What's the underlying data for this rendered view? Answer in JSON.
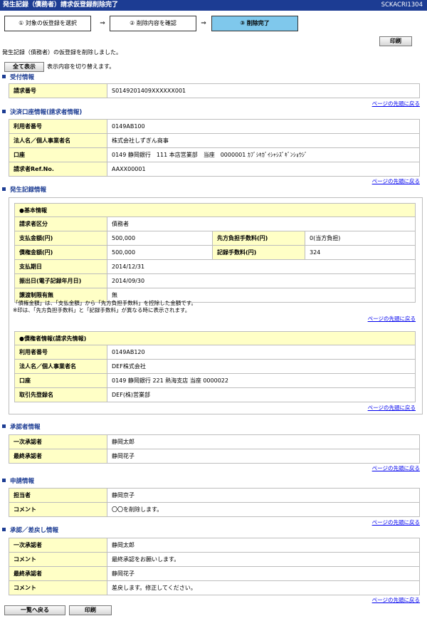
{
  "header": {
    "title": "発生記録（債務者）請求仮登録削除完了",
    "screen_code": "SCKACRI1304"
  },
  "steps": [
    {
      "label": "① 対象の仮登録を選択",
      "active": false
    },
    {
      "label": "② 削除内容を確認",
      "active": false
    },
    {
      "label": "③ 削除完了",
      "active": true
    }
  ],
  "step_arrow": "⇒",
  "buttons": {
    "print_top": "印刷",
    "show_all": "全て表示",
    "back_to_list": "一覧へ戻る",
    "print_bottom": "印刷"
  },
  "messages": {
    "completed": "発生記録（債務者）の仮登録を削除しました。",
    "toggle_hint": "表示内容を切り替えます。"
  },
  "page_top_link": "ページの先頭に戻る",
  "request_info": {
    "heading": "受付情報",
    "rows": [
      {
        "label": "請求番号",
        "value": "S0149201409XXXXXX001"
      }
    ]
  },
  "settlement_account": {
    "heading": "決済口座情報(請求者情報)",
    "rows": [
      {
        "label": "利用者番号",
        "value": "0149AB100"
      },
      {
        "label": "法人名／個人事業者名",
        "value": "株式会社しずぎん商事"
      },
      {
        "label": "口座",
        "value": "0149 静岡銀行　111 本店営業部　当座　0000001 ｶﾌﾞｼｷｶﾞｲｼｬｼｽﾞｷﾞﾝｼｮｳｼﾞ"
      },
      {
        "label": "請求者Ref.No.",
        "value": "AAXX00001"
      }
    ]
  },
  "record_info": {
    "heading": "発生記録情報",
    "basic": {
      "heading": "●基本情報",
      "requester_type_label": "請求者区分",
      "requester_type_value": "債務者",
      "payment_amount_label": "支払金額(円)",
      "payment_amount_value": "500,000",
      "fee_label": "先方負担手数料(円)",
      "fee_value": "0(当方負担)",
      "claim_amount_label": "債権金額(円)",
      "claim_amount_value": "500,000",
      "record_fee_label": "記録手数料(円)",
      "record_fee_value": "324",
      "due_date_label": "支払期日",
      "due_date_value": "2014/12/31",
      "issue_date_label": "振出日(電子記録年月日)",
      "issue_date_value": "2014/09/30",
      "transfer_limit_label": "譲渡制限有無",
      "transfer_limit_value": "無"
    },
    "notes": [
      "「債権金額」は、「支払金額」から「先方負担手数料」を控除した金額です。",
      "※印は、「先方負担手数料」と「記録手数料」が異なる時に表示されます。"
    ],
    "creditor": {
      "heading": "●債権者情報(請求先情報)",
      "rows": [
        {
          "label": "利用者番号",
          "value": "0149AB120"
        },
        {
          "label": "法人名／個人事業者名",
          "value": "DEF株式会社"
        },
        {
          "label": "口座",
          "value": "0149 静岡銀行 221 熱海支店 当座 0000022"
        },
        {
          "label": "取引先登録名",
          "value": "DEF(株)営業部"
        }
      ]
    }
  },
  "approver_info": {
    "heading": "承認者情報",
    "rows": [
      {
        "label": "一次承認者",
        "value": "静岡太郎"
      },
      {
        "label": "最終承認者",
        "value": "静岡花子"
      }
    ]
  },
  "application_info": {
    "heading": "申請情報",
    "rows": [
      {
        "label": "担当者",
        "value": "静岡京子"
      },
      {
        "label": "コメント",
        "value": "〇〇を削除します。"
      }
    ]
  },
  "approval_return_info": {
    "heading": "承認／差戻し情報",
    "rows": [
      {
        "label": "一次承認者",
        "value": "静岡太郎"
      },
      {
        "label": "コメント",
        "value": "最終承認をお願いします。"
      },
      {
        "label": "最終承認者",
        "value": "静岡花子"
      },
      {
        "label": "コメント",
        "value": "差戻します。修正してください。"
      }
    ]
  }
}
